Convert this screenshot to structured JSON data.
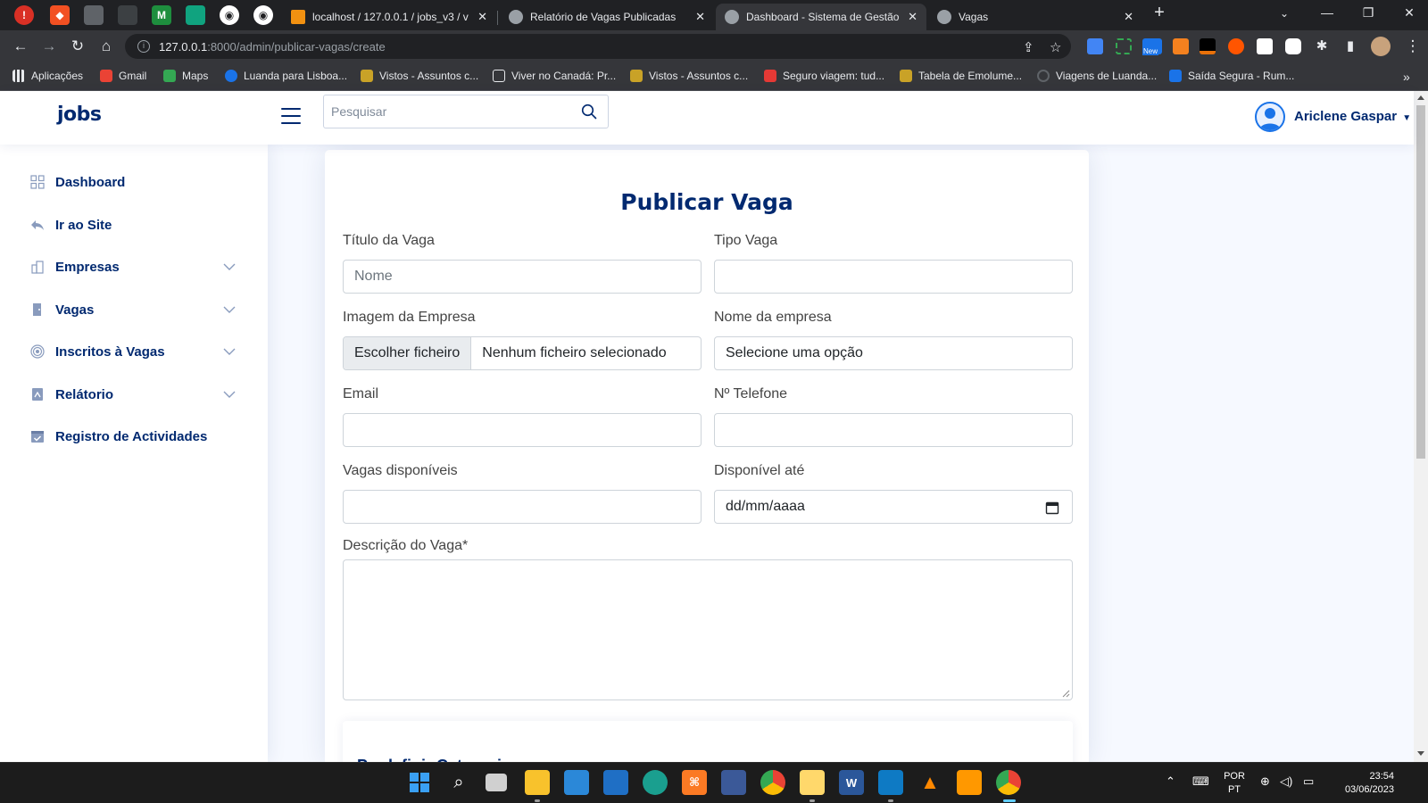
{
  "browser": {
    "tabs": [
      {
        "title": "localhost / 127.0.0.1 / jobs_v3 / v",
        "active": false
      },
      {
        "title": "Relatório de Vagas Publicadas",
        "active": false
      },
      {
        "title": "Dashboard - Sistema de Gestão d",
        "active": true
      },
      {
        "title": "Vagas",
        "active": false
      }
    ],
    "url_host": "127.0.0.1",
    "url_path": ":8000/admin/publicar-vagas/create",
    "extension_badge": "New",
    "bookmarks": [
      "Aplicações",
      "Gmail",
      "Maps",
      "Luanda para Lisboa...",
      "Vistos - Assuntos c...",
      "Viver no Canadá: Pr...",
      "Vistos - Assuntos c...",
      "Seguro viagem: tud...",
      "Tabela de Emolume...",
      "Viagens de Luanda...",
      "Saída Segura - Rum..."
    ]
  },
  "header": {
    "logo": "jobs",
    "search_placeholder": "Pesquisar",
    "user_name": "Ariclene Gaspar"
  },
  "sidebar": {
    "items": [
      {
        "label": "Dashboard",
        "icon": "grid-icon",
        "expandable": false
      },
      {
        "label": "Ir ao Site",
        "icon": "reply-icon",
        "expandable": false
      },
      {
        "label": "Empresas",
        "icon": "building-icon",
        "expandable": true
      },
      {
        "label": "Vagas",
        "icon": "door-icon",
        "expandable": true
      },
      {
        "label": "Inscritos à Vagas",
        "icon": "target-icon",
        "expandable": true
      },
      {
        "label": "Relátorio",
        "icon": "report-icon",
        "expandable": true
      },
      {
        "label": "Registro de Actividades",
        "icon": "calendar-check-icon",
        "expandable": false
      }
    ]
  },
  "form": {
    "title": "Publicar Vaga",
    "titulo_label": "Título da Vaga",
    "titulo_placeholder": "Nome",
    "tipo_label": "Tipo Vaga",
    "tipo_value": "",
    "imagem_label": "Imagem da Empresa",
    "file_button": "Escolher ficheiro",
    "file_status": "Nenhum ficheiro selecionado",
    "empresa_label": "Nome da empresa",
    "empresa_value": "Selecione uma opção",
    "email_label": "Email",
    "email_value": "",
    "telefone_label": "Nº Telefone",
    "telefone_value": "",
    "vagas_label": "Vagas disponíveis",
    "vagas_value": "",
    "disponivel_label": "Disponível até",
    "disponivel_placeholder": "dd/mm/aaaa",
    "descricao_label": "Descrição do Vaga*",
    "descricao_value": "",
    "categorias_title": "Predefinir Categorias"
  },
  "taskbar": {
    "lang_top": "POR",
    "lang_bottom": "PT",
    "time": "23:54",
    "date": "03/06/2023"
  },
  "colors": {
    "brand": "#012970",
    "accent": "#4154f1",
    "page_bg": "#f6f9ff"
  }
}
